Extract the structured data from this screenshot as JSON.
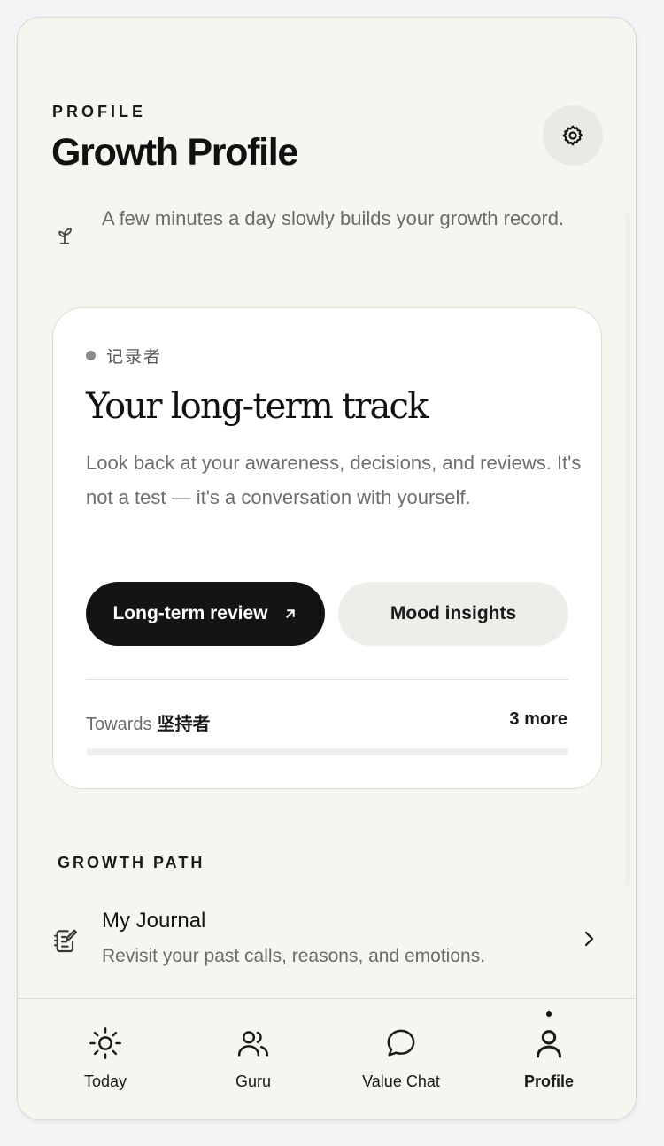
{
  "header": {
    "eyebrow": "PROFILE",
    "title": "Growth Profile",
    "settings_icon": "gear-icon"
  },
  "tagline": {
    "icon": "sprout-icon",
    "text": "A few minutes a day slowly builds your growth record."
  },
  "card": {
    "badge": "记录者",
    "title": "Your long-term track",
    "description": "Look back at your awareness, decisions, and reviews. It's not a test — it's a conversation with yourself.",
    "primary_button": {
      "label": "Long-term review",
      "icon": "arrow-up-right-icon"
    },
    "secondary_button": {
      "label": "Mood insights"
    },
    "progress": {
      "prefix": "Towards",
      "target": "坚持者",
      "remaining": "3 more",
      "value": 0
    }
  },
  "growth_path": {
    "label": "GROWTH PATH",
    "items": [
      {
        "icon": "journal-icon",
        "title": "My Journal",
        "subtitle": "Revisit your past calls, reasons, and emotions."
      }
    ]
  },
  "tabbar": {
    "tabs": [
      {
        "label": "Today",
        "icon": "sun-icon",
        "active": false
      },
      {
        "label": "Guru",
        "icon": "users-icon",
        "active": false
      },
      {
        "label": "Value Chat",
        "icon": "chat-bubble-icon",
        "active": false
      },
      {
        "label": "Profile",
        "icon": "person-icon",
        "active": true
      }
    ]
  },
  "colors": {
    "background": "#f7f5ef",
    "card": "#ffffff",
    "primary": "#141414",
    "secondary_button": "#efedea",
    "muted_text": "#6b6b6b"
  }
}
